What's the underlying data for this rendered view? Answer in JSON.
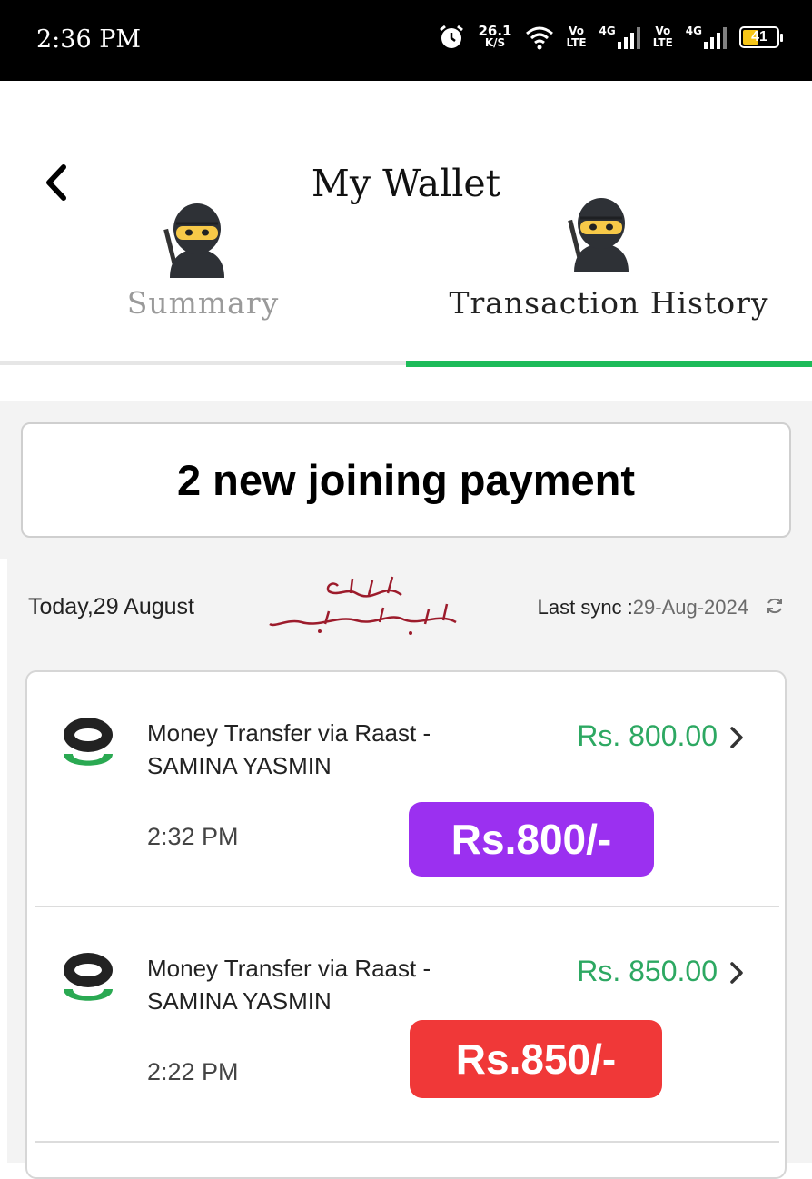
{
  "status_bar": {
    "time": "2:36 PM",
    "net_speed": "26.1",
    "net_unit": "K/S",
    "sim1_vo": "Vo",
    "sim1_lte": "LTE",
    "sim1_gen": "4G",
    "sim2_vo": "Vo",
    "sim2_lte": "LTE",
    "sim2_gen": "4G",
    "battery": "41"
  },
  "header": {
    "title": "My Wallet",
    "tabs": [
      {
        "label": "Summary",
        "active": false
      },
      {
        "label": "Transaction History",
        "active": true
      }
    ],
    "accent_color": "#1dbb59"
  },
  "banner": {
    "text": "2 new joining payment"
  },
  "list_header": {
    "date": "Today,29 August",
    "sync_label": "Last sync :",
    "sync_value": "29-Aug-2024"
  },
  "transactions": [
    {
      "line1": "Money Transfer via Raast -",
      "line2": "SAMINA YASMIN",
      "amount": "Rs. 800.00",
      "time": "2:32 PM",
      "badge": "Rs.800/-",
      "badge_color": "#9b30f0"
    },
    {
      "line1": "Money Transfer via Raast -",
      "line2": "SAMINA YASMIN",
      "amount": "Rs. 850.00",
      "time": "2:22 PM",
      "badge": "Rs.850/-",
      "badge_color": "#f03838"
    }
  ]
}
